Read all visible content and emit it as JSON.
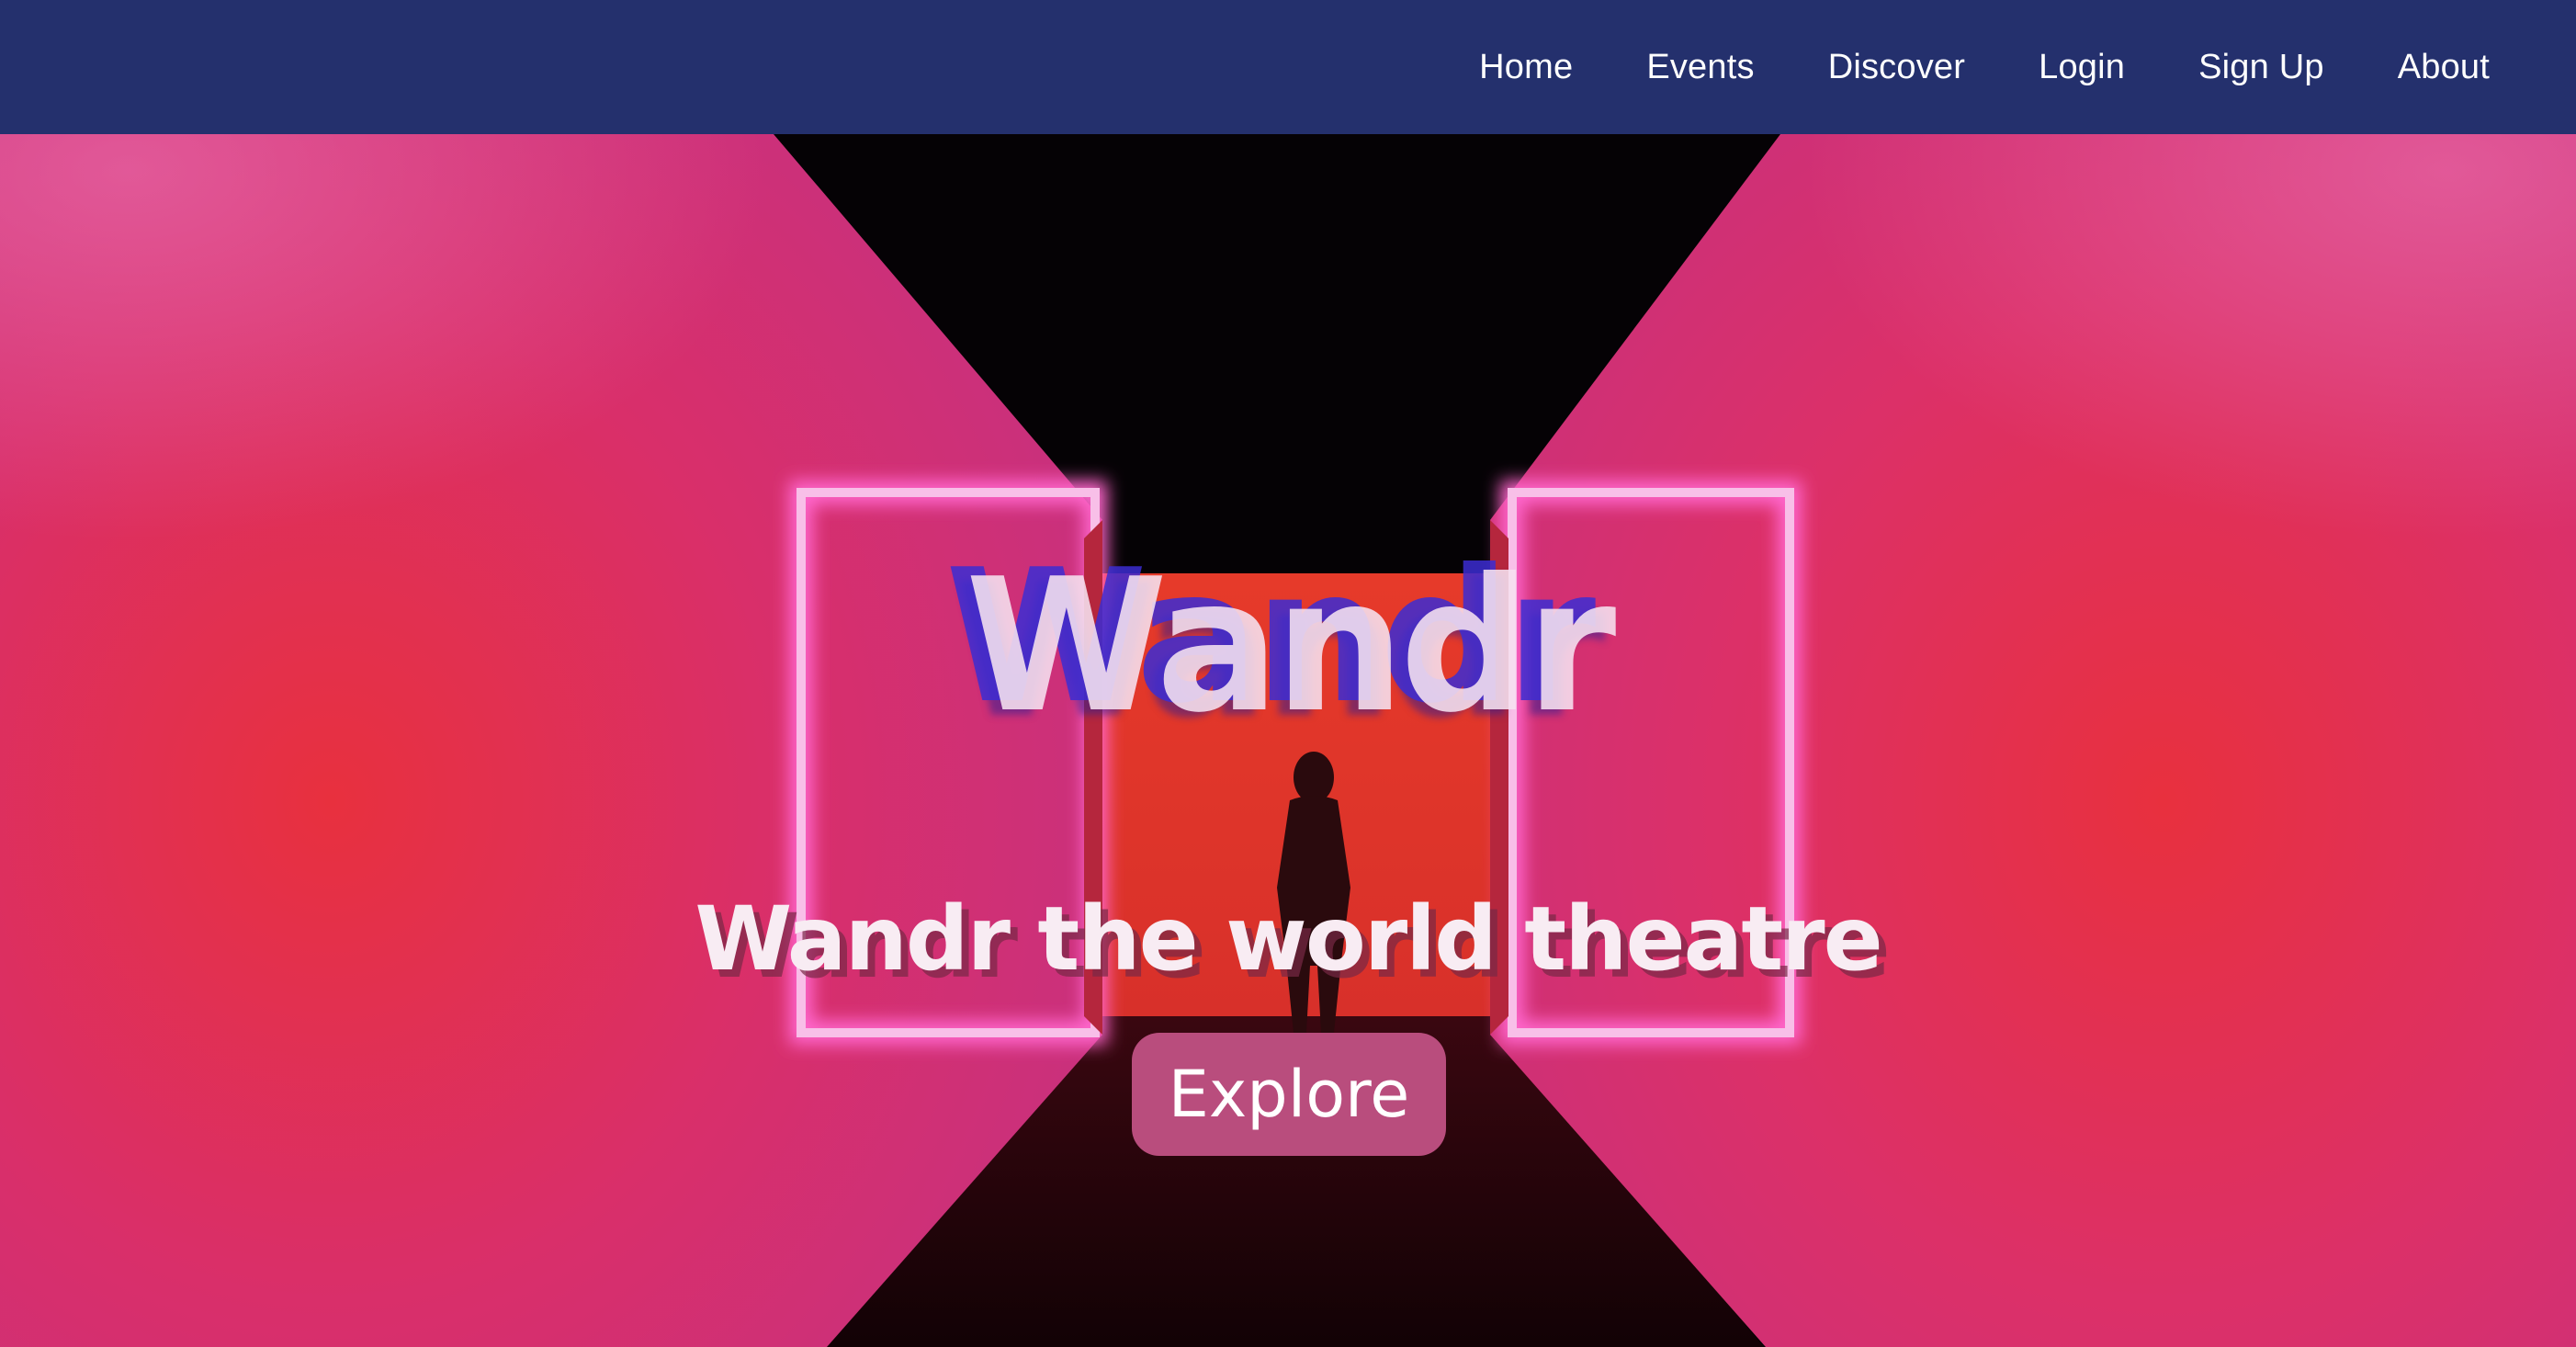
{
  "nav": {
    "links": [
      {
        "label": "Home"
      },
      {
        "label": "Events"
      },
      {
        "label": "Discover"
      },
      {
        "label": "Login"
      },
      {
        "label": "Sign Up"
      },
      {
        "label": "About"
      }
    ]
  },
  "hero": {
    "title": "Wandr",
    "subtitle": "Wandr the world theatre",
    "button_label": "Explore"
  },
  "colors": {
    "navbar_bg": "#24306d",
    "accent_pink": "#e0348a",
    "neon_red": "#e8303a",
    "button_bg": "#b94d7d"
  }
}
